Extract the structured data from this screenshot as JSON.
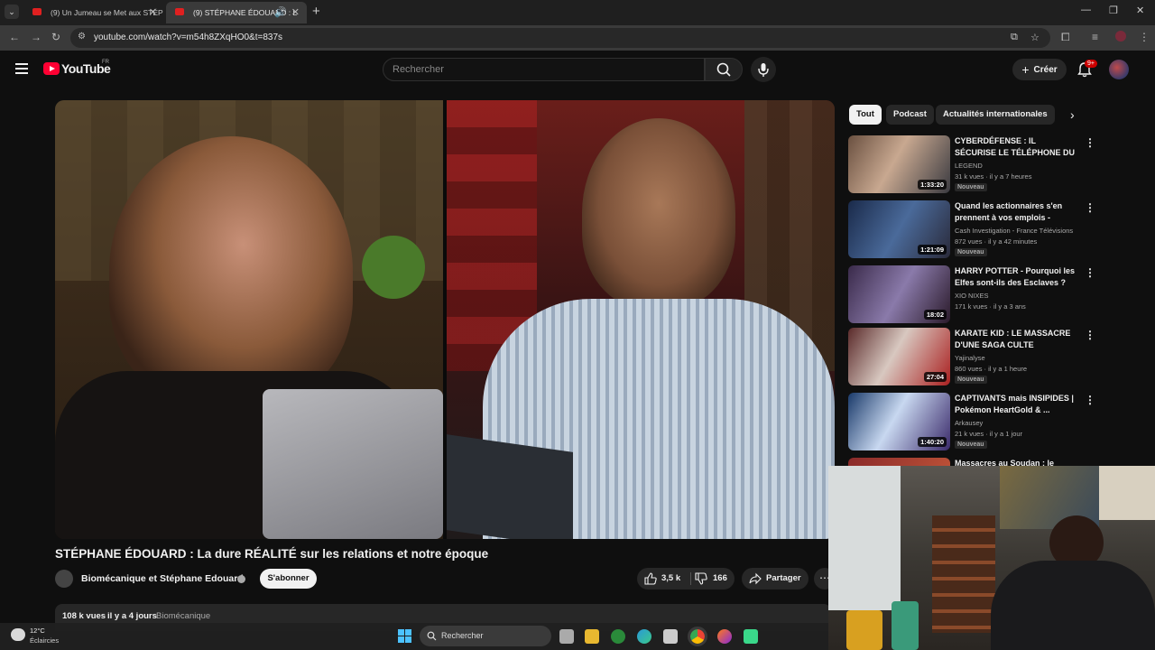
{
  "browser": {
    "tabs": [
      {
        "title": "(9) Un Jumeau se Met aux STÉP",
        "active": false
      },
      {
        "title": "(9) STÉPHANE ÉDOUARD : L",
        "active": true
      }
    ],
    "url": "youtube.com/watch?v=m54h8ZXqHO0&t=837s"
  },
  "header": {
    "logo": "YouTube",
    "country": "FR",
    "search_placeholder": "Rechercher",
    "create_label": "Créer",
    "notifications": "9+"
  },
  "video": {
    "title": "STÉPHANE ÉDOUARD : La dure RÉALITÉ sur les relations et notre époque",
    "channel": "Biomécanique et Stéphane Edouard",
    "subscribe_label": "S'abonner",
    "likes": "3,5 k",
    "dislikes": "166",
    "share_label": "Partager",
    "views": "108 k vues",
    "age": "il y a 4 jours",
    "tag": "Biomécanique"
  },
  "chips": [
    "Tout",
    "Podcast",
    "Actualités internationales"
  ],
  "recommendations": [
    {
      "title": "CYBERDÉFENSE : IL SÉCURISE LE TÉLÉPHONE DU PRÉSIDEN...",
      "channel": "LEGEND",
      "meta": "31 k vues · il y a 7 heures",
      "duration": "1:33:20",
      "badge": "Nouveau"
    },
    {
      "title": "Quand les actionnaires s'en prennent à vos emplois - Cash...",
      "channel": "Cash Investigation - France Télévisions",
      "meta": "872 vues · il y a 42 minutes",
      "duration": "1:21:09",
      "badge": "Nouveau"
    },
    {
      "title": "HARRY POTTER - Pourquoi les Elfes sont-ils des Esclaves ?",
      "channel": "XIO NIXES",
      "meta": "171 k vues · il y a 3 ans",
      "duration": "18:02",
      "badge": ""
    },
    {
      "title": "KARATE KID : LE MASSACRE D'UNE SAGA CULTE",
      "channel": "Yajinalyse",
      "meta": "860 vues · il y a 1 heure",
      "duration": "27:04",
      "badge": "Nouveau"
    },
    {
      "title": "CAPTIVANTS mais INSIPIDES | Pokémon HeartGold & ...",
      "channel": "Arkausey",
      "meta": "21 k vues · il y a 1 jour",
      "duration": "1:40:20",
      "badge": "Nouveau"
    },
    {
      "title": "Massacres au Soudan : le",
      "channel": "",
      "meta": "",
      "duration": "",
      "badge": ""
    }
  ],
  "taskbar": {
    "temperature": "12°C",
    "weather": "Éclaircies",
    "search_label": "Rechercher"
  },
  "colors": {
    "background": "#0f0f0f",
    "brand_red": "#ff0033",
    "chip_bg": "#272727"
  }
}
